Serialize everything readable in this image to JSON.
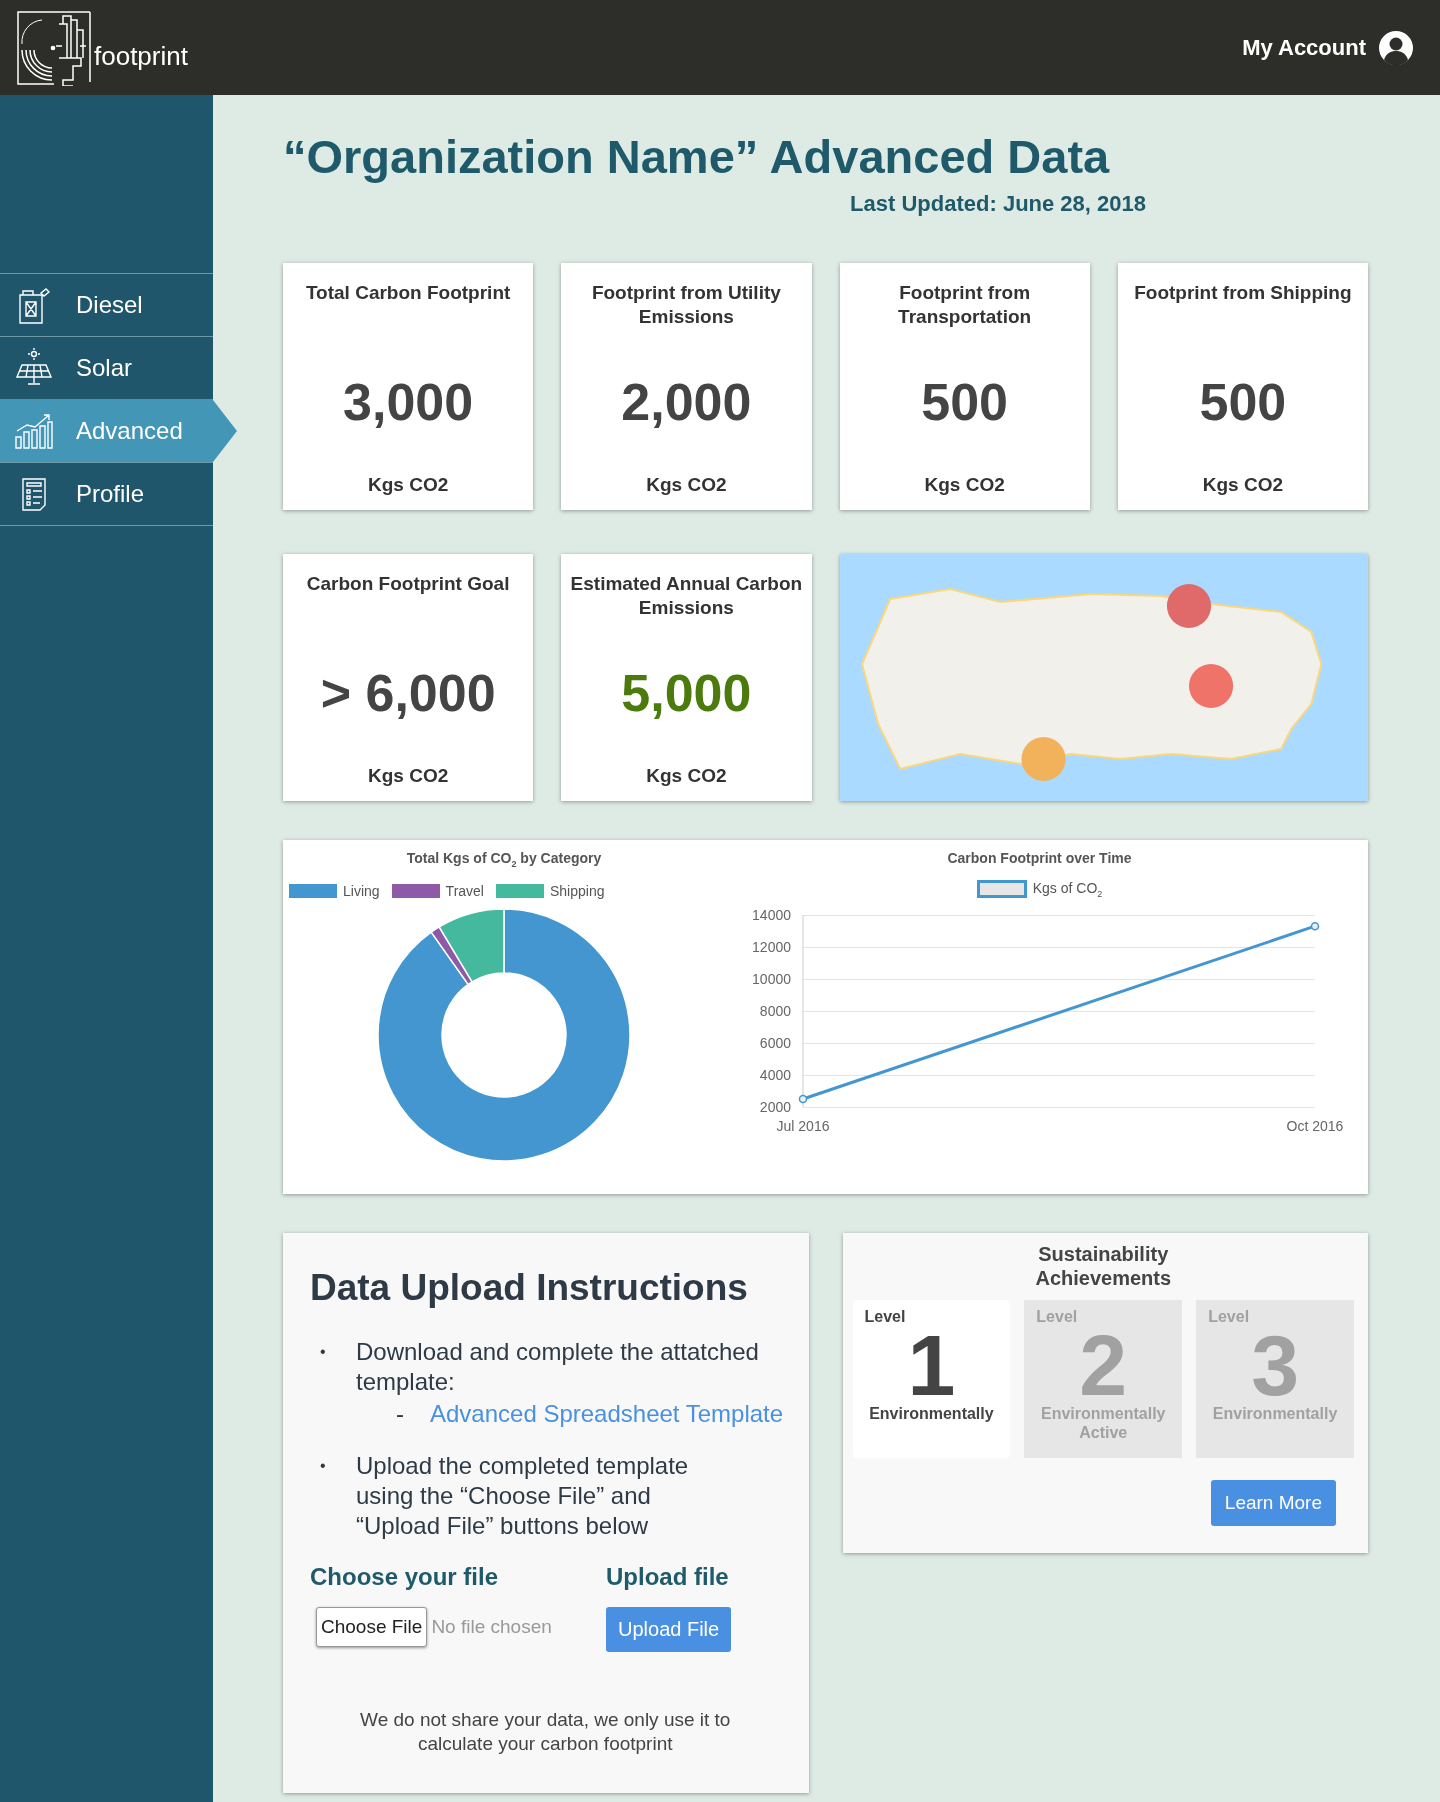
{
  "header": {
    "logo_text": "footprint",
    "account_label": "My Account"
  },
  "sidebar": {
    "items": [
      {
        "label": "Diesel",
        "selected": false
      },
      {
        "label": "Solar",
        "selected": false
      },
      {
        "label": "Advanced",
        "selected": true
      },
      {
        "label": "Profile",
        "selected": false
      }
    ]
  },
  "page": {
    "title": "“Organization Name” Advanced Data",
    "last_updated": "Last Updated: June 28, 2018"
  },
  "stat_cards": [
    {
      "title": "Total Carbon Footprint",
      "value": "3,000",
      "unit": "Kgs CO2",
      "color": "#444444"
    },
    {
      "title": "Footprint from Utility Emissions",
      "value": "2,000",
      "unit": "Kgs CO2",
      "color": "#444444"
    },
    {
      "title": "Footprint from Transportation",
      "value": "500",
      "unit": "Kgs CO2",
      "color": "#444444"
    },
    {
      "title": "Footprint from Shipping",
      "value": "500",
      "unit": "Kgs CO2",
      "color": "#444444"
    },
    {
      "title": "Carbon Footprint Goal",
      "value": "> 6,000",
      "unit": "Kgs CO2",
      "color": "#444444"
    },
    {
      "title": "Estimated Annual Carbon Emissions",
      "value": "5,000",
      "unit": "Kgs CO2",
      "color": "#4b7b0c"
    }
  ],
  "map": {
    "markers": [
      {
        "color": "#e0696a"
      },
      {
        "color": "#f0736a"
      },
      {
        "color": "#f2b25c"
      }
    ]
  },
  "category_chart": {
    "title": "Total Kgs of CO$_{2}$ by Category",
    "legend": [
      {
        "label": "Living",
        "color": "#4396cf"
      },
      {
        "label": "Travel",
        "color": "#8e5aa8"
      },
      {
        "label": "Shipping",
        "color": "#45b99e"
      }
    ]
  },
  "time_chart": {
    "chart_data": {
      "type": "line",
      "title": "Carbon Footprint over Time",
      "categories": [
        "Jul 2016",
        "Oct 2016"
      ],
      "series": [
        {
          "name": "Kgs of CO$_{2}$",
          "color": "#4396cf",
          "marker": true,
          "values": [
            2500,
            13300
          ]
        }
      ],
      "ylim": [
        2000,
        14000
      ],
      "yticks": [
        2000,
        4000,
        6000,
        8000,
        10000,
        12000,
        14000
      ]
    }
  },
  "upload": {
    "title": "Data Upload Instructions",
    "steps": [
      {
        "bullet": "•",
        "text": "Download and complete the attatched template:",
        "link_marker": "-",
        "link": "Advanced Spreadsheet Template"
      },
      {
        "bullet": "•",
        "text": "Upload the completed template using the “Choose File” and “Upload File” buttons below"
      }
    ],
    "choose_label": "Choose your file",
    "choose_button": "Choose File",
    "file_status": "No file chosen",
    "upload_label": "Upload file",
    "upload_button": "Upload File",
    "note": "We do not share your data, we only use it to calculate your carbon footprint"
  },
  "achievements": {
    "title": "Sustainability Achievements",
    "levels": [
      {
        "label": "Level",
        "number": "1",
        "name": "Environmentally",
        "achieved": true
      },
      {
        "label": "Level",
        "number": "2",
        "name": "Environmentally Active",
        "achieved": false
      },
      {
        "label": "Level",
        "number": "3",
        "name": "Environmentally",
        "achieved": false
      }
    ],
    "button": "Learn More"
  }
}
